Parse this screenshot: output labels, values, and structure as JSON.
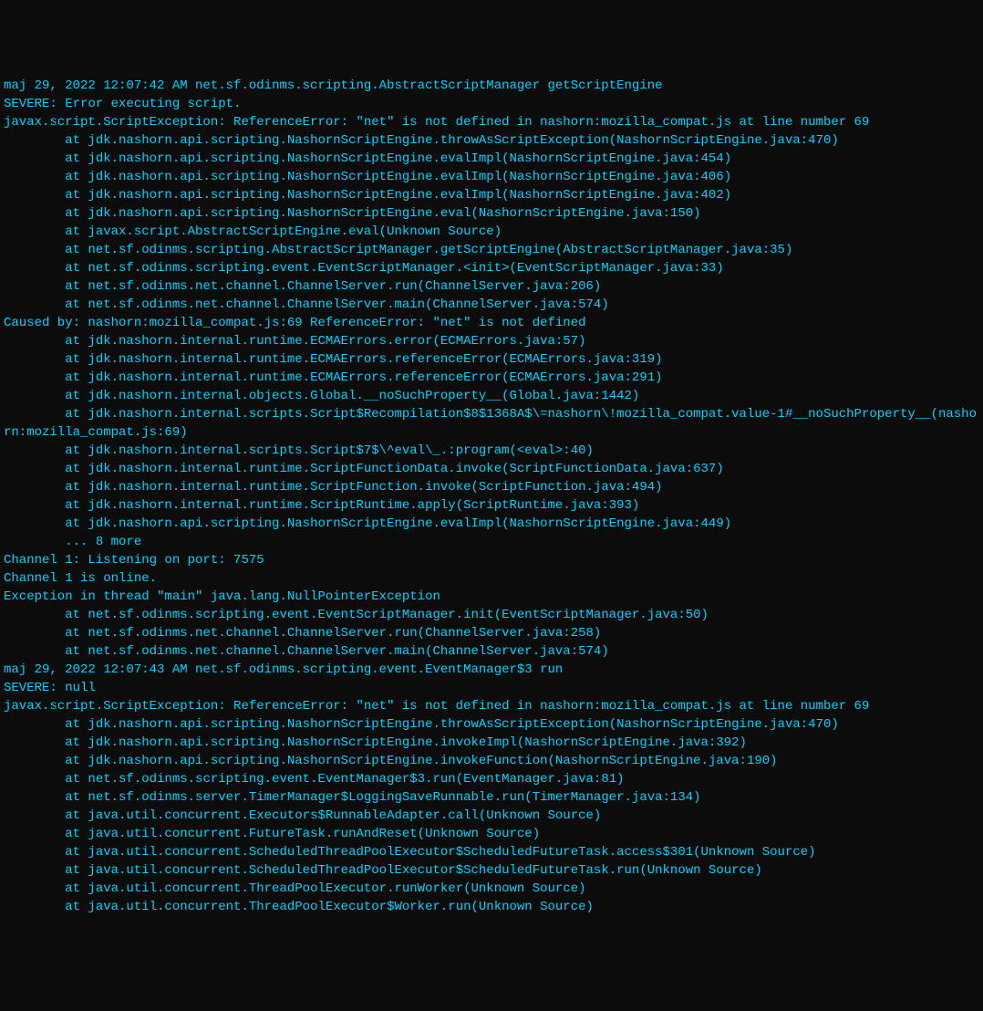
{
  "lines": [
    "maj 29, 2022 12:07:42 AM net.sf.odinms.scripting.AbstractScriptManager getScriptEngine",
    "SEVERE: Error executing script.",
    "javax.script.ScriptException: ReferenceError: \"net\" is not defined in nashorn:mozilla_compat.js at line number 69",
    "        at jdk.nashorn.api.scripting.NashornScriptEngine.throwAsScriptException(NashornScriptEngine.java:470)",
    "        at jdk.nashorn.api.scripting.NashornScriptEngine.evalImpl(NashornScriptEngine.java:454)",
    "        at jdk.nashorn.api.scripting.NashornScriptEngine.evalImpl(NashornScriptEngine.java:406)",
    "        at jdk.nashorn.api.scripting.NashornScriptEngine.evalImpl(NashornScriptEngine.java:402)",
    "        at jdk.nashorn.api.scripting.NashornScriptEngine.eval(NashornScriptEngine.java:150)",
    "        at javax.script.AbstractScriptEngine.eval(Unknown Source)",
    "        at net.sf.odinms.scripting.AbstractScriptManager.getScriptEngine(AbstractScriptManager.java:35)",
    "        at net.sf.odinms.scripting.event.EventScriptManager.<init>(EventScriptManager.java:33)",
    "        at net.sf.odinms.net.channel.ChannelServer.run(ChannelServer.java:206)",
    "        at net.sf.odinms.net.channel.ChannelServer.main(ChannelServer.java:574)",
    "Caused by: nashorn:mozilla_compat.js:69 ReferenceError: \"net\" is not defined",
    "        at jdk.nashorn.internal.runtime.ECMAErrors.error(ECMAErrors.java:57)",
    "        at jdk.nashorn.internal.runtime.ECMAErrors.referenceError(ECMAErrors.java:319)",
    "        at jdk.nashorn.internal.runtime.ECMAErrors.referenceError(ECMAErrors.java:291)",
    "        at jdk.nashorn.internal.objects.Global.__noSuchProperty__(Global.java:1442)",
    "        at jdk.nashorn.internal.scripts.Script$Recompilation$8$1368A$\\=nashorn\\!mozilla_compat.value-1#__noSuchProperty__(nashorn:mozilla_compat.js:69)",
    "        at jdk.nashorn.internal.scripts.Script$7$\\^eval\\_.:program(<eval>:40)",
    "        at jdk.nashorn.internal.runtime.ScriptFunctionData.invoke(ScriptFunctionData.java:637)",
    "        at jdk.nashorn.internal.runtime.ScriptFunction.invoke(ScriptFunction.java:494)",
    "        at jdk.nashorn.internal.runtime.ScriptRuntime.apply(ScriptRuntime.java:393)",
    "        at jdk.nashorn.api.scripting.NashornScriptEngine.evalImpl(NashornScriptEngine.java:449)",
    "        ... 8 more",
    "",
    "Channel 1: Listening on port: 7575",
    "Channel 1 is online.",
    "Exception in thread \"main\" java.lang.NullPointerException",
    "        at net.sf.odinms.scripting.event.EventScriptManager.init(EventScriptManager.java:50)",
    "        at net.sf.odinms.net.channel.ChannelServer.run(ChannelServer.java:258)",
    "        at net.sf.odinms.net.channel.ChannelServer.main(ChannelServer.java:574)",
    "maj 29, 2022 12:07:43 AM net.sf.odinms.scripting.event.EventManager$3 run",
    "SEVERE: null",
    "javax.script.ScriptException: ReferenceError: \"net\" is not defined in nashorn:mozilla_compat.js at line number 69",
    "        at jdk.nashorn.api.scripting.NashornScriptEngine.throwAsScriptException(NashornScriptEngine.java:470)",
    "        at jdk.nashorn.api.scripting.NashornScriptEngine.invokeImpl(NashornScriptEngine.java:392)",
    "        at jdk.nashorn.api.scripting.NashornScriptEngine.invokeFunction(NashornScriptEngine.java:190)",
    "        at net.sf.odinms.scripting.event.EventManager$3.run(EventManager.java:81)",
    "        at net.sf.odinms.server.TimerManager$LoggingSaveRunnable.run(TimerManager.java:134)",
    "        at java.util.concurrent.Executors$RunnableAdapter.call(Unknown Source)",
    "        at java.util.concurrent.FutureTask.runAndReset(Unknown Source)",
    "        at java.util.concurrent.ScheduledThreadPoolExecutor$ScheduledFutureTask.access$301(Unknown Source)",
    "        at java.util.concurrent.ScheduledThreadPoolExecutor$ScheduledFutureTask.run(Unknown Source)",
    "        at java.util.concurrent.ThreadPoolExecutor.runWorker(Unknown Source)",
    "        at java.util.concurrent.ThreadPoolExecutor$Worker.run(Unknown Source)"
  ]
}
